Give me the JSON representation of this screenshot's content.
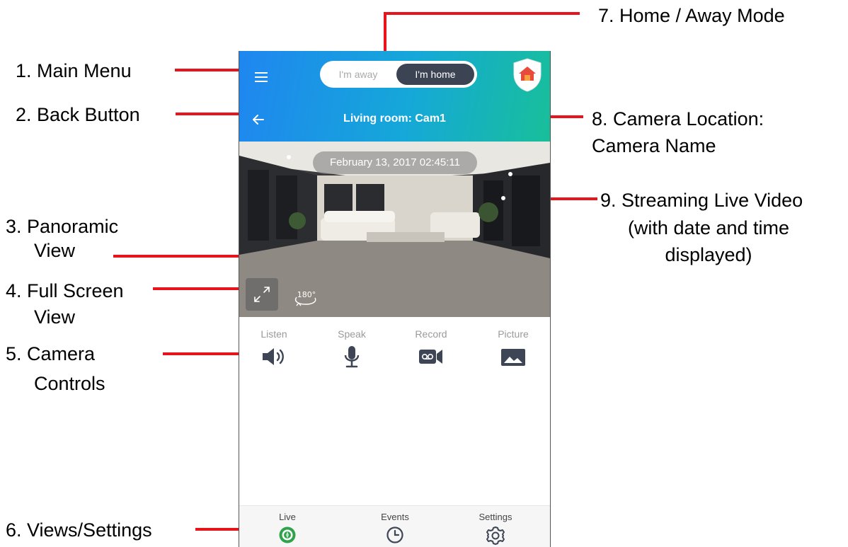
{
  "annotations": [
    {
      "id": "main-menu",
      "text": "1. Main Menu"
    },
    {
      "id": "back-button",
      "text": "2. Back Button"
    },
    {
      "id": "panoramic-1",
      "text": "3. Panoramic"
    },
    {
      "id": "panoramic-2",
      "text": "View"
    },
    {
      "id": "fullscreen-1",
      "text": "4. Full Screen"
    },
    {
      "id": "fullscreen-2",
      "text": "View"
    },
    {
      "id": "controls-1",
      "text": "5. Camera"
    },
    {
      "id": "controls-2",
      "text": "Controls"
    },
    {
      "id": "views-settings",
      "text": "6. Views/Settings"
    },
    {
      "id": "mode",
      "text": "7. Home / Away Mode"
    },
    {
      "id": "location-1",
      "text": "8. Camera Location:"
    },
    {
      "id": "location-2",
      "text": "Camera Name"
    },
    {
      "id": "video-1",
      "text": "9. Streaming Live Video"
    },
    {
      "id": "video-2",
      "text": "(with date and time"
    },
    {
      "id": "video-3",
      "text": "displayed)"
    }
  ],
  "app": {
    "mode_toggle": {
      "away_label": "I'm away",
      "home_label": "I'm home",
      "selected": "I'm home"
    },
    "camera_title": "Living room: Cam1",
    "video": {
      "timestamp": "February 13, 2017 02:45:11",
      "panoramic_badge": "180°"
    },
    "controls": [
      {
        "label": "Listen",
        "icon": "speaker-icon"
      },
      {
        "label": "Speak",
        "icon": "microphone-icon"
      },
      {
        "label": "Record",
        "icon": "record-icon"
      },
      {
        "label": "Picture",
        "icon": "picture-icon"
      }
    ],
    "bottom_nav": [
      {
        "label": "Live",
        "icon": "live-icon",
        "active": true
      },
      {
        "label": "Events",
        "icon": "clock-icon",
        "active": false
      },
      {
        "label": "Settings",
        "icon": "gear-icon",
        "active": false
      }
    ]
  },
  "colors": {
    "callout_line": "#e8141b",
    "appbar_start": "#1f86f0",
    "appbar_end": "#18bf9a",
    "toggle_selected": "#3c4454",
    "control_icon": "#3e4656",
    "live_active": "#2ea34a",
    "shield_house": "#e84a3c"
  }
}
